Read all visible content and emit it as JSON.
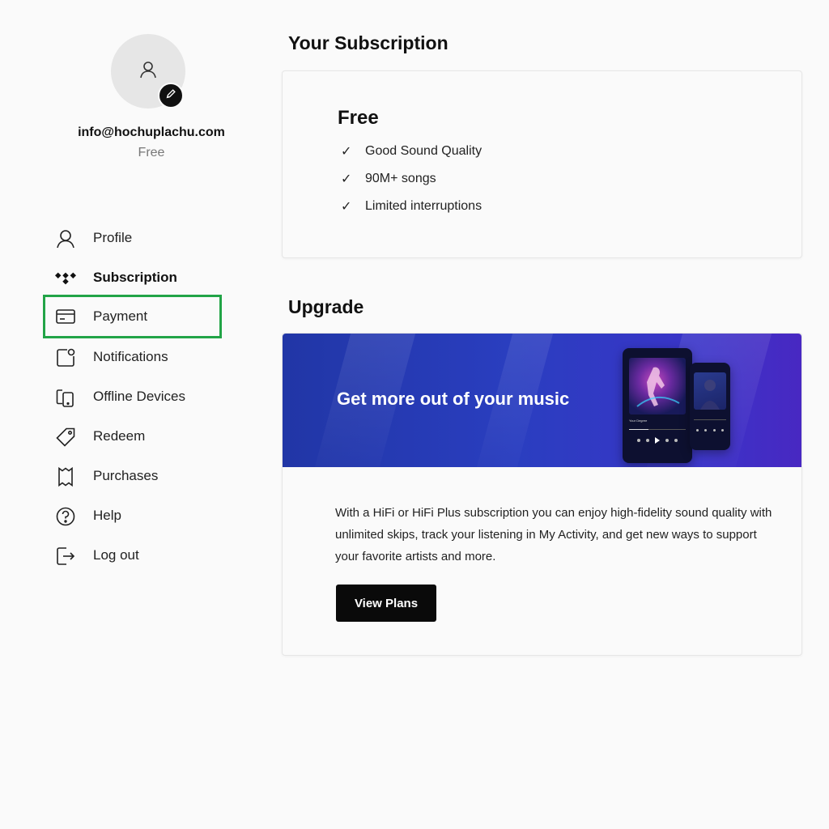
{
  "account": {
    "email": "info@hochuplachu.com",
    "plan": "Free"
  },
  "sidebar": {
    "items": [
      {
        "label": "Profile",
        "icon": "user-icon"
      },
      {
        "label": "Subscription",
        "icon": "tidal-logo-icon",
        "active": true
      },
      {
        "label": "Payment",
        "icon": "credit-card-icon",
        "highlighted": true,
        "highlight_color": "#22a447"
      },
      {
        "label": "Notifications",
        "icon": "notification-icon"
      },
      {
        "label": "Offline Devices",
        "icon": "devices-icon"
      },
      {
        "label": "Redeem",
        "icon": "tag-icon"
      },
      {
        "label": "Purchases",
        "icon": "receipt-icon"
      },
      {
        "label": "Help",
        "icon": "help-icon"
      },
      {
        "label": "Log out",
        "icon": "logout-icon"
      }
    ]
  },
  "subscription": {
    "section_title": "Your Subscription",
    "plan_name": "Free",
    "features": [
      "Good Sound Quality",
      "90M+ songs",
      "Limited interruptions"
    ]
  },
  "upgrade": {
    "section_title": "Upgrade",
    "banner_text": "Get more out of your music",
    "banner_phone_caption": "Your Degree",
    "description": "With a HiFi or HiFi Plus subscription you can enjoy high-fidelity sound quality with unlimited skips, track your listening in My Activity, and get new ways to support your favorite artists and more.",
    "button_label": "View Plans"
  },
  "colors": {
    "background": "#fafafa",
    "highlight": "#22a447",
    "banner_start": "#2136a6",
    "banner_end": "#4828c2",
    "button": "#0a0a0a"
  }
}
